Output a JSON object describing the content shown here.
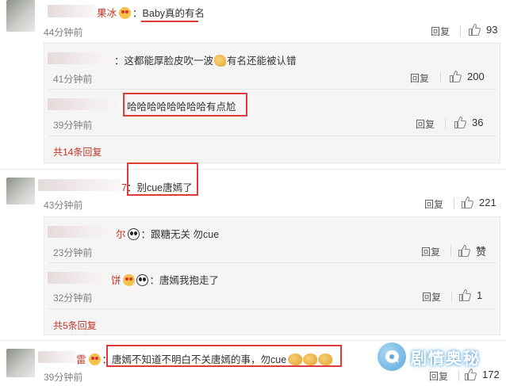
{
  "comments": [
    {
      "nick_tail": "果冰",
      "text": "Baby真的有名",
      "time": "44分钟前",
      "reply_label": "回复",
      "likes": "93",
      "replies": [
        {
          "nick_tail": "",
          "text": "：这都能厚脸皮吹一波",
          "text_after": "有名还能被认错",
          "time": "41分钟前",
          "reply_label": "回复",
          "likes": "200"
        },
        {
          "nick_tail": "",
          "text": "哈哈哈哈哈哈哈哈有点尬",
          "time": "39分钟前",
          "reply_label": "回复",
          "likes": "36"
        }
      ],
      "more_label": "共14条回复"
    },
    {
      "nick_tail": "7",
      "text": "：别cue唐嫣了",
      "time": "43分钟前",
      "reply_label": "回复",
      "likes": "221",
      "replies": [
        {
          "nick_tail": "尔",
          "text": "：跟糖无关 勿cue",
          "time": "23分钟前",
          "reply_label": "回复",
          "likes": "赞"
        },
        {
          "nick_tail": "饼",
          "text": "：唐嫣我抱走了",
          "time": "32分钟前",
          "reply_label": "回复",
          "likes": "1"
        }
      ],
      "more_label": "共5条回复"
    },
    {
      "nick_tail": "雷",
      "text": "：唐嫣不知道不明白不关唐嫣的事，勿cue",
      "time": "39分钟前",
      "reply_label": "回复",
      "likes": "172"
    }
  ],
  "colors": {
    "highlight": "#e03a3a",
    "nick": "#c0392b",
    "more": "#c0392b"
  },
  "icons": {
    "like": "thumbs-up-icon"
  },
  "watermark": {
    "text": "剧情奥秘"
  }
}
